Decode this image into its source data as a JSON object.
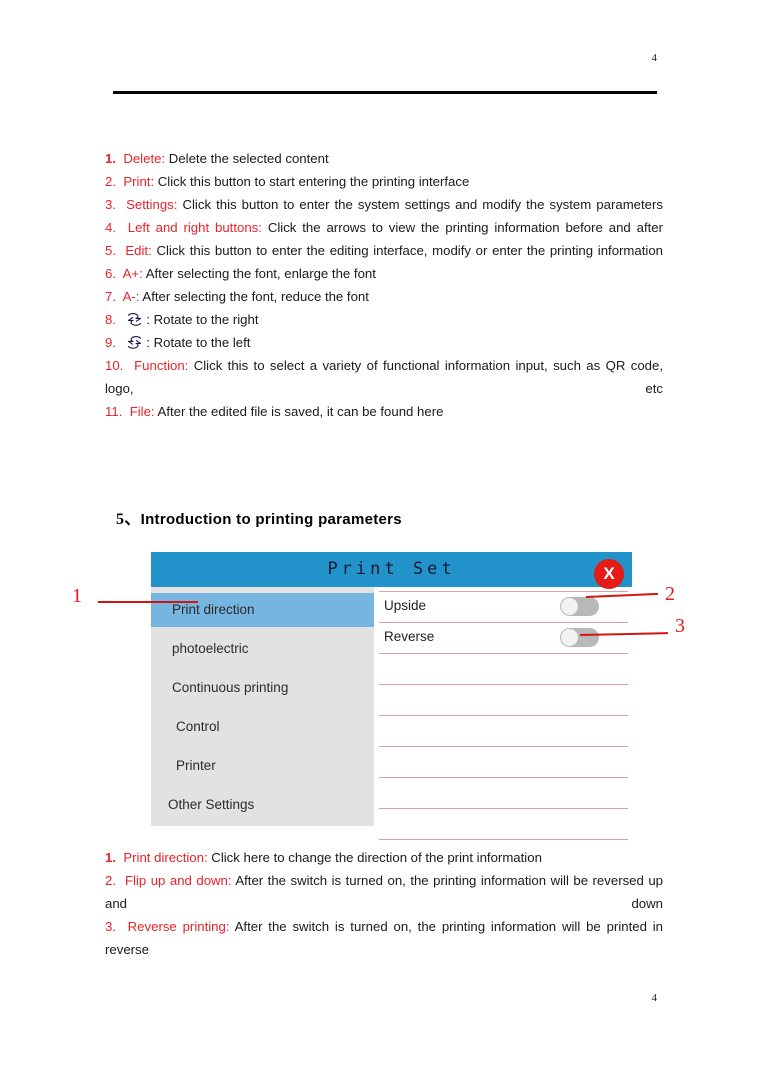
{
  "page": {
    "header_number": "4",
    "footer_number": "4"
  },
  "top_list": [
    {
      "num": "1.",
      "label": "Delete:",
      "text": "Delete the selected content",
      "num_bold": true,
      "justify": false
    },
    {
      "num": "2.",
      "label": "Print:",
      "text": "Click this button to start entering the printing interface",
      "num_bold": false,
      "justify": false
    },
    {
      "num": "3.",
      "label": "Settings:",
      "text": "Click this button to enter the system settings and modify the system parameters",
      "num_bold": false,
      "justify": true,
      "label_black": true
    },
    {
      "num": "4.",
      "label": "Left and right buttons:",
      "text": "Click the arrows to view the printing information before and after",
      "num_bold": false,
      "justify": true
    },
    {
      "num": "5.",
      "label": "Edit:",
      "text": "Click this button to enter the editing interface, modify or enter the printing information",
      "num_bold": false,
      "justify": true
    },
    {
      "num": "6.",
      "label": "A+:",
      "text": "After selecting the font, enlarge the font",
      "num_bold": false,
      "justify": false
    },
    {
      "num": "7.",
      "label": "A-:",
      "text": "After selecting the font, reduce the font",
      "num_bold": false,
      "justify": false
    },
    {
      "num": "8.",
      "label": "",
      "icon": "rotate-right-icon",
      "text": ": Rotate to the right",
      "num_bold": false,
      "justify": false
    },
    {
      "num": "9.",
      "label": "",
      "icon": "rotate-left-icon",
      "text": ": Rotate to the left",
      "num_bold": false,
      "justify": false
    },
    {
      "num": "10.",
      "label": "Function:",
      "text": "Click this to select a variety of functional information input, such as QR code, logo, etc",
      "num_bold": false,
      "justify": true
    },
    {
      "num": "11.",
      "label": "File:",
      "text": "After the edited file is saved, it can be found here",
      "num_bold": false,
      "justify": false
    }
  ],
  "section": {
    "number": "5、",
    "title": "Introduction to printing parameters"
  },
  "dialog": {
    "title": "Print Set",
    "close_label": "X",
    "accent_color": "#2292ca",
    "close_color": "#e51b18",
    "selected_color": "#76b5e0",
    "sidebar": [
      {
        "label": "Print direction",
        "selected": true,
        "indent": 0
      },
      {
        "label": "photoelectric",
        "selected": false,
        "indent": 0
      },
      {
        "label": "Continuous printing",
        "selected": false,
        "indent": 0
      },
      {
        "label": "Control",
        "selected": false,
        "indent": 1
      },
      {
        "label": "Printer",
        "selected": false,
        "indent": 1
      },
      {
        "label": "Other Settings",
        "selected": false,
        "indent": 2
      }
    ],
    "rows": [
      {
        "label": "Upside",
        "toggle": true,
        "toggle_on": false
      },
      {
        "label": "Reverse",
        "toggle": true,
        "toggle_on": false
      },
      {
        "label": "",
        "toggle": false
      },
      {
        "label": "",
        "toggle": false
      },
      {
        "label": "",
        "toggle": false
      },
      {
        "label": "",
        "toggle": false
      },
      {
        "label": "",
        "toggle": false
      },
      {
        "label": "",
        "toggle": false
      }
    ]
  },
  "callouts": [
    {
      "number": "1"
    },
    {
      "number": "2"
    },
    {
      "number": "3"
    }
  ],
  "bottom_list": [
    {
      "num": "1.",
      "label": "Print direction:",
      "text": "Click here to change the direction of the print information",
      "num_bold": true,
      "justify": false
    },
    {
      "num": "2.",
      "label": "Flip up and down:",
      "text": "After the switch is turned on, the printing information will be reversed up and down",
      "num_bold": false,
      "justify": true
    },
    {
      "num": "3.",
      "label": "Reverse printing:",
      "text": "After the switch is turned on, the printing information will be printed in reverse",
      "num_bold": false,
      "justify": true
    }
  ]
}
